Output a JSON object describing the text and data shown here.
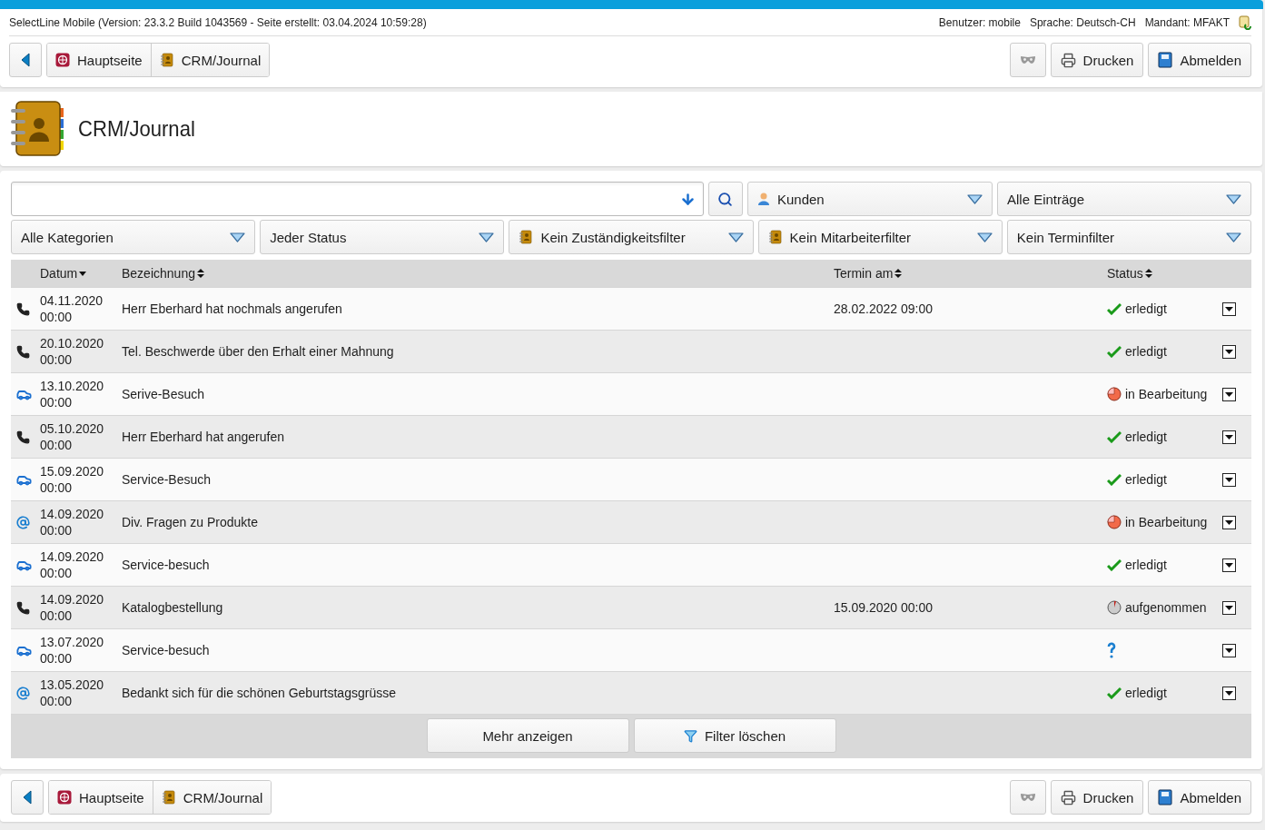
{
  "header": {
    "info": "SelectLine Mobile (Version: 23.3.2 Build 1043569 - Seite erstellt: 03.04.2024 10:59:28)",
    "user": "Benutzer: mobile",
    "language": "Sprache: Deutsch-CH",
    "client": "Mandant: MFAKT"
  },
  "top_nav": {
    "breadcrumbs": [
      {
        "label": "Hauptseite",
        "kind": "home"
      },
      {
        "label": "CRM/Journal",
        "kind": "journal"
      }
    ],
    "buttons": [
      {
        "label": "Drucken",
        "kind": "print"
      },
      {
        "label": "Abmelden",
        "kind": "logout"
      }
    ]
  },
  "page_title": "CRM/Journal",
  "filters_row_1": [
    {
      "label": "Kunden",
      "kind": "person"
    },
    {
      "label": "Alle Einträge",
      "kind": "plain"
    }
  ],
  "filters_row_2": [
    {
      "label": "Alle Kategorien",
      "kind": "plain"
    },
    {
      "label": "Jeder Status",
      "kind": "plain"
    },
    {
      "label": "Kein Zuständigkeitsfilter",
      "kind": "journal"
    },
    {
      "label": "Kein Mitarbeiterfilter",
      "kind": "journal"
    },
    {
      "label": "Kein Terminfilter",
      "kind": "plain"
    }
  ],
  "table": {
    "columns": [
      {
        "label": "Datum",
        "sorted": true
      },
      {
        "label": "Bezeichnung",
        "sorted": false
      },
      {
        "label": "Termin am",
        "sorted": false
      },
      {
        "label": "Status",
        "sorted": false
      }
    ],
    "rows": [
      {
        "kind": "call",
        "date": "04.11.2020",
        "time": "00:00",
        "title": "Herr Eberhard hat nochmals angerufen",
        "appointment": "28.02.2022 09:00",
        "status": {
          "kind": "done",
          "label": "erledigt"
        }
      },
      {
        "kind": "call",
        "date": "20.10.2020",
        "time": "00:00",
        "title": "Tel. Beschwerde über den Erhalt einer Mahnung",
        "status": {
          "kind": "done",
          "label": "erledigt"
        }
      },
      {
        "kind": "visit",
        "date": "13.10.2020",
        "time": "00:00",
        "title": "Serive-Besuch",
        "status": {
          "kind": "in_progress",
          "label": "in Bearbeitung"
        }
      },
      {
        "kind": "call",
        "date": "05.10.2020",
        "time": "00:00",
        "title": "Herr Eberhard hat angerufen",
        "status": {
          "kind": "done",
          "label": "erledigt"
        }
      },
      {
        "kind": "visit",
        "date": "15.09.2020",
        "time": "00:00",
        "title": "Service-Besuch",
        "status": {
          "kind": "done",
          "label": "erledigt"
        }
      },
      {
        "kind": "email",
        "date": "14.09.2020",
        "time": "00:00",
        "title": "Div. Fragen zu Produkte",
        "status": {
          "kind": "in_progress",
          "label": "in Bearbeitung"
        }
      },
      {
        "kind": "visit",
        "date": "14.09.2020",
        "time": "00:00",
        "title": "Service-besuch",
        "status": {
          "kind": "done",
          "label": "erledigt"
        }
      },
      {
        "kind": "call",
        "date": "14.09.2020",
        "time": "00:00",
        "title": "Katalogbestellung",
        "appointment": "15.09.2020 00:00",
        "status": {
          "kind": "recorded",
          "label": "aufgenommen"
        }
      },
      {
        "kind": "visit",
        "date": "13.07.2020",
        "time": "00:00",
        "title": "Service-besuch",
        "status": {
          "kind": "unknown"
        }
      },
      {
        "kind": "email",
        "date": "13.05.2020",
        "time": "00:00",
        "title": "Bedankt sich für die schönen Geburtstagsgrüsse",
        "status": {
          "kind": "done",
          "label": "erledigt"
        }
      }
    ]
  },
  "table_actions": [
    {
      "label": "Mehr anzeigen",
      "kind": "plain"
    },
    {
      "label": "Filter löschen",
      "kind": "filter"
    }
  ],
  "bottom_nav": {
    "breadcrumbs": [
      {
        "label": "Hauptseite",
        "kind": "home"
      },
      {
        "label": "CRM/Journal",
        "kind": "journal"
      }
    ],
    "buttons": [
      {
        "label": "Drucken",
        "kind": "print"
      },
      {
        "label": "Abmelden",
        "kind": "logout"
      }
    ]
  }
}
